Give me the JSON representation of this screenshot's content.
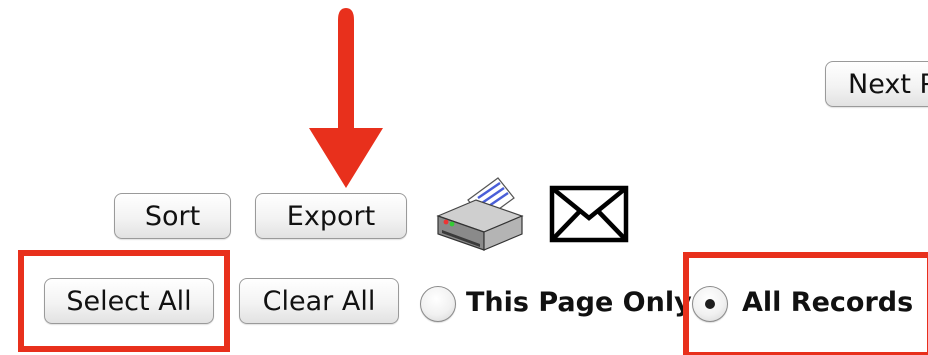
{
  "toolbar": {
    "next_label": "Next P",
    "sort_label": "Sort",
    "export_label": "Export",
    "print_icon": "printer-icon",
    "email_icon": "envelope-icon"
  },
  "selection": {
    "select_all_label": "Select All",
    "clear_all_label": "Clear All"
  },
  "scope": {
    "options": [
      {
        "label": "This Page Only",
        "selected": false
      },
      {
        "label": "All Records",
        "selected": true
      }
    ]
  },
  "annotation": {
    "color": "#e8301c"
  }
}
